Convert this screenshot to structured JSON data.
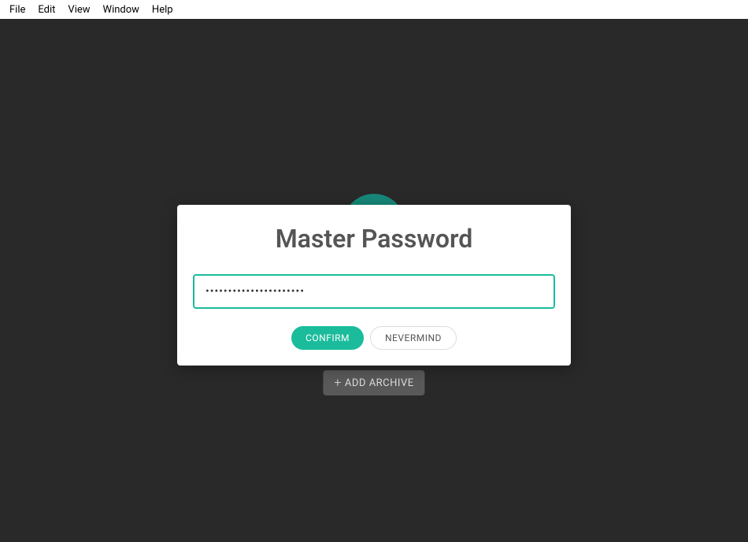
{
  "menubar": {
    "items": [
      "File",
      "Edit",
      "View",
      "Window",
      "Help"
    ]
  },
  "modal": {
    "title": "Master Password",
    "password_value": "••••••••••••••••••••••",
    "confirm_label": "CONFIRM",
    "nevermind_label": "NEVERMIND"
  },
  "main": {
    "add_archive_label": "ADD ARCHIVE"
  },
  "colors": {
    "accent": "#1abc9c",
    "background_dark": "#292929"
  }
}
